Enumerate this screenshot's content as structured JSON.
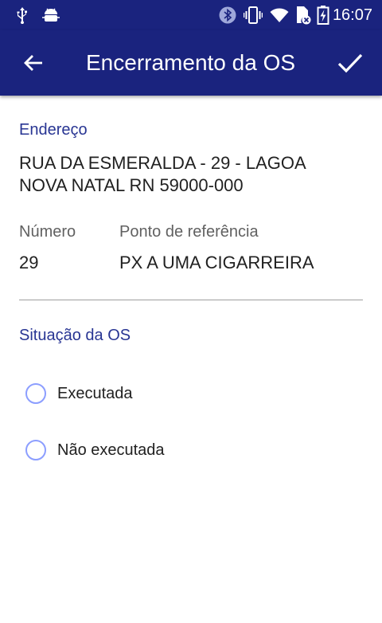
{
  "status_bar": {
    "time": "16:07",
    "icons": [
      "usb-icon",
      "android-debug-icon",
      "bluetooth-icon",
      "vibrate-icon",
      "wifi-icon",
      "no-sim-icon",
      "battery-charging-icon"
    ]
  },
  "app_bar": {
    "title": "Encerramento da OS",
    "back_icon": "arrow-back-icon",
    "confirm_icon": "check-icon"
  },
  "address": {
    "label": "Endereço",
    "line1": "RUA DA ESMERALDA - 29 - LAGOA",
    "line2": "NOVA NATAL RN 59000-000"
  },
  "numero": {
    "label": "Número",
    "value": "29"
  },
  "referencia": {
    "label": "Ponto de referência",
    "value": "PX A UMA CIGARREIRA"
  },
  "situacao": {
    "label": "Situação da OS",
    "options": [
      {
        "label": "Executada",
        "selected": false
      },
      {
        "label": "Não executada",
        "selected": false
      }
    ]
  },
  "colors": {
    "primary": "#1a237e",
    "accent_label": "#283593",
    "radio_outline": "#8c9eff"
  }
}
